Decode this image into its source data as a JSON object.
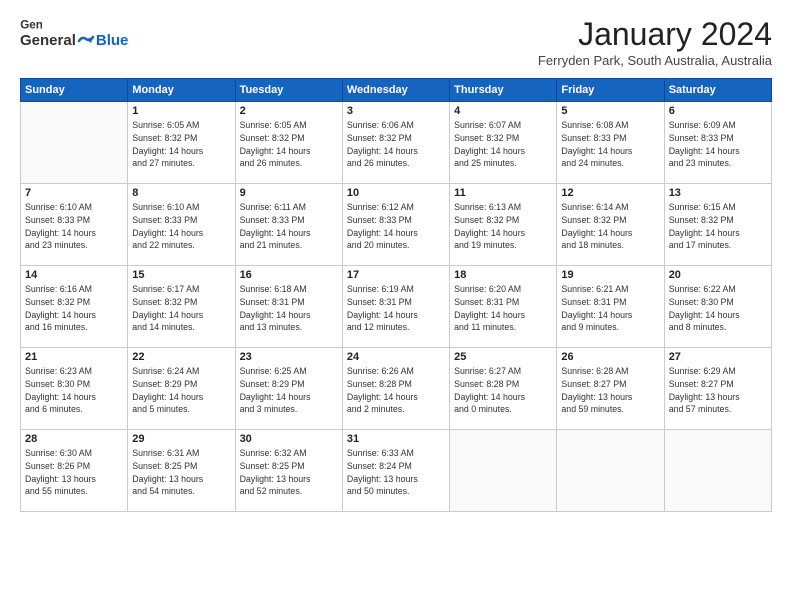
{
  "header": {
    "logo": {
      "general": "General",
      "blue": "Blue"
    },
    "title": "January 2024",
    "location": "Ferryden Park, South Australia, Australia"
  },
  "weekdays": [
    "Sunday",
    "Monday",
    "Tuesday",
    "Wednesday",
    "Thursday",
    "Friday",
    "Saturday"
  ],
  "weeks": [
    [
      {
        "day": "",
        "info": ""
      },
      {
        "day": "1",
        "info": "Sunrise: 6:05 AM\nSunset: 8:32 PM\nDaylight: 14 hours\nand 27 minutes."
      },
      {
        "day": "2",
        "info": "Sunrise: 6:05 AM\nSunset: 8:32 PM\nDaylight: 14 hours\nand 26 minutes."
      },
      {
        "day": "3",
        "info": "Sunrise: 6:06 AM\nSunset: 8:32 PM\nDaylight: 14 hours\nand 26 minutes."
      },
      {
        "day": "4",
        "info": "Sunrise: 6:07 AM\nSunset: 8:32 PM\nDaylight: 14 hours\nand 25 minutes."
      },
      {
        "day": "5",
        "info": "Sunrise: 6:08 AM\nSunset: 8:33 PM\nDaylight: 14 hours\nand 24 minutes."
      },
      {
        "day": "6",
        "info": "Sunrise: 6:09 AM\nSunset: 8:33 PM\nDaylight: 14 hours\nand 23 minutes."
      }
    ],
    [
      {
        "day": "7",
        "info": "Sunrise: 6:10 AM\nSunset: 8:33 PM\nDaylight: 14 hours\nand 23 minutes."
      },
      {
        "day": "8",
        "info": "Sunrise: 6:10 AM\nSunset: 8:33 PM\nDaylight: 14 hours\nand 22 minutes."
      },
      {
        "day": "9",
        "info": "Sunrise: 6:11 AM\nSunset: 8:33 PM\nDaylight: 14 hours\nand 21 minutes."
      },
      {
        "day": "10",
        "info": "Sunrise: 6:12 AM\nSunset: 8:33 PM\nDaylight: 14 hours\nand 20 minutes."
      },
      {
        "day": "11",
        "info": "Sunrise: 6:13 AM\nSunset: 8:32 PM\nDaylight: 14 hours\nand 19 minutes."
      },
      {
        "day": "12",
        "info": "Sunrise: 6:14 AM\nSunset: 8:32 PM\nDaylight: 14 hours\nand 18 minutes."
      },
      {
        "day": "13",
        "info": "Sunrise: 6:15 AM\nSunset: 8:32 PM\nDaylight: 14 hours\nand 17 minutes."
      }
    ],
    [
      {
        "day": "14",
        "info": "Sunrise: 6:16 AM\nSunset: 8:32 PM\nDaylight: 14 hours\nand 16 minutes."
      },
      {
        "day": "15",
        "info": "Sunrise: 6:17 AM\nSunset: 8:32 PM\nDaylight: 14 hours\nand 14 minutes."
      },
      {
        "day": "16",
        "info": "Sunrise: 6:18 AM\nSunset: 8:31 PM\nDaylight: 14 hours\nand 13 minutes."
      },
      {
        "day": "17",
        "info": "Sunrise: 6:19 AM\nSunset: 8:31 PM\nDaylight: 14 hours\nand 12 minutes."
      },
      {
        "day": "18",
        "info": "Sunrise: 6:20 AM\nSunset: 8:31 PM\nDaylight: 14 hours\nand 11 minutes."
      },
      {
        "day": "19",
        "info": "Sunrise: 6:21 AM\nSunset: 8:31 PM\nDaylight: 14 hours\nand 9 minutes."
      },
      {
        "day": "20",
        "info": "Sunrise: 6:22 AM\nSunset: 8:30 PM\nDaylight: 14 hours\nand 8 minutes."
      }
    ],
    [
      {
        "day": "21",
        "info": "Sunrise: 6:23 AM\nSunset: 8:30 PM\nDaylight: 14 hours\nand 6 minutes."
      },
      {
        "day": "22",
        "info": "Sunrise: 6:24 AM\nSunset: 8:29 PM\nDaylight: 14 hours\nand 5 minutes."
      },
      {
        "day": "23",
        "info": "Sunrise: 6:25 AM\nSunset: 8:29 PM\nDaylight: 14 hours\nand 3 minutes."
      },
      {
        "day": "24",
        "info": "Sunrise: 6:26 AM\nSunset: 8:28 PM\nDaylight: 14 hours\nand 2 minutes."
      },
      {
        "day": "25",
        "info": "Sunrise: 6:27 AM\nSunset: 8:28 PM\nDaylight: 14 hours\nand 0 minutes."
      },
      {
        "day": "26",
        "info": "Sunrise: 6:28 AM\nSunset: 8:27 PM\nDaylight: 13 hours\nand 59 minutes."
      },
      {
        "day": "27",
        "info": "Sunrise: 6:29 AM\nSunset: 8:27 PM\nDaylight: 13 hours\nand 57 minutes."
      }
    ],
    [
      {
        "day": "28",
        "info": "Sunrise: 6:30 AM\nSunset: 8:26 PM\nDaylight: 13 hours\nand 55 minutes."
      },
      {
        "day": "29",
        "info": "Sunrise: 6:31 AM\nSunset: 8:25 PM\nDaylight: 13 hours\nand 54 minutes."
      },
      {
        "day": "30",
        "info": "Sunrise: 6:32 AM\nSunset: 8:25 PM\nDaylight: 13 hours\nand 52 minutes."
      },
      {
        "day": "31",
        "info": "Sunrise: 6:33 AM\nSunset: 8:24 PM\nDaylight: 13 hours\nand 50 minutes."
      },
      {
        "day": "",
        "info": ""
      },
      {
        "day": "",
        "info": ""
      },
      {
        "day": "",
        "info": ""
      }
    ]
  ]
}
